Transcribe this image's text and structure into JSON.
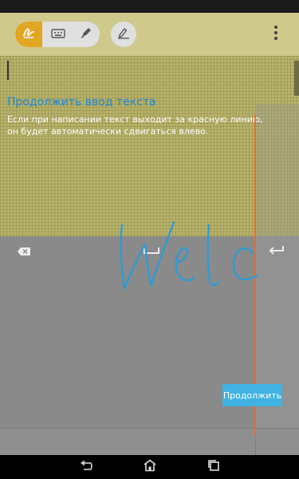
{
  "hint": {
    "title": "Продолжить ввод текста",
    "body": "Если при написании текст выходит за красную линию, он будет автоматически сдвигаться влево."
  },
  "handwriting": {
    "ink_text": "Welc",
    "ink_color": "#2e9bd6"
  },
  "buttons": {
    "continue_label": "Продолжить"
  },
  "colors": {
    "accent": "#e3a623",
    "button": "#41b2e3",
    "guide_line": "#f06a2c",
    "hint_title": "#1e88d6"
  },
  "icons": {
    "toolbar": [
      "handwriting-icon",
      "keyboard-icon",
      "pen-icon",
      "edit-settings-icon",
      "overflow-menu-icon"
    ],
    "keyboard": [
      "backspace-icon",
      "space-icon",
      "enter-icon"
    ],
    "navigation": [
      "back-icon",
      "home-icon",
      "recents-icon"
    ]
  }
}
